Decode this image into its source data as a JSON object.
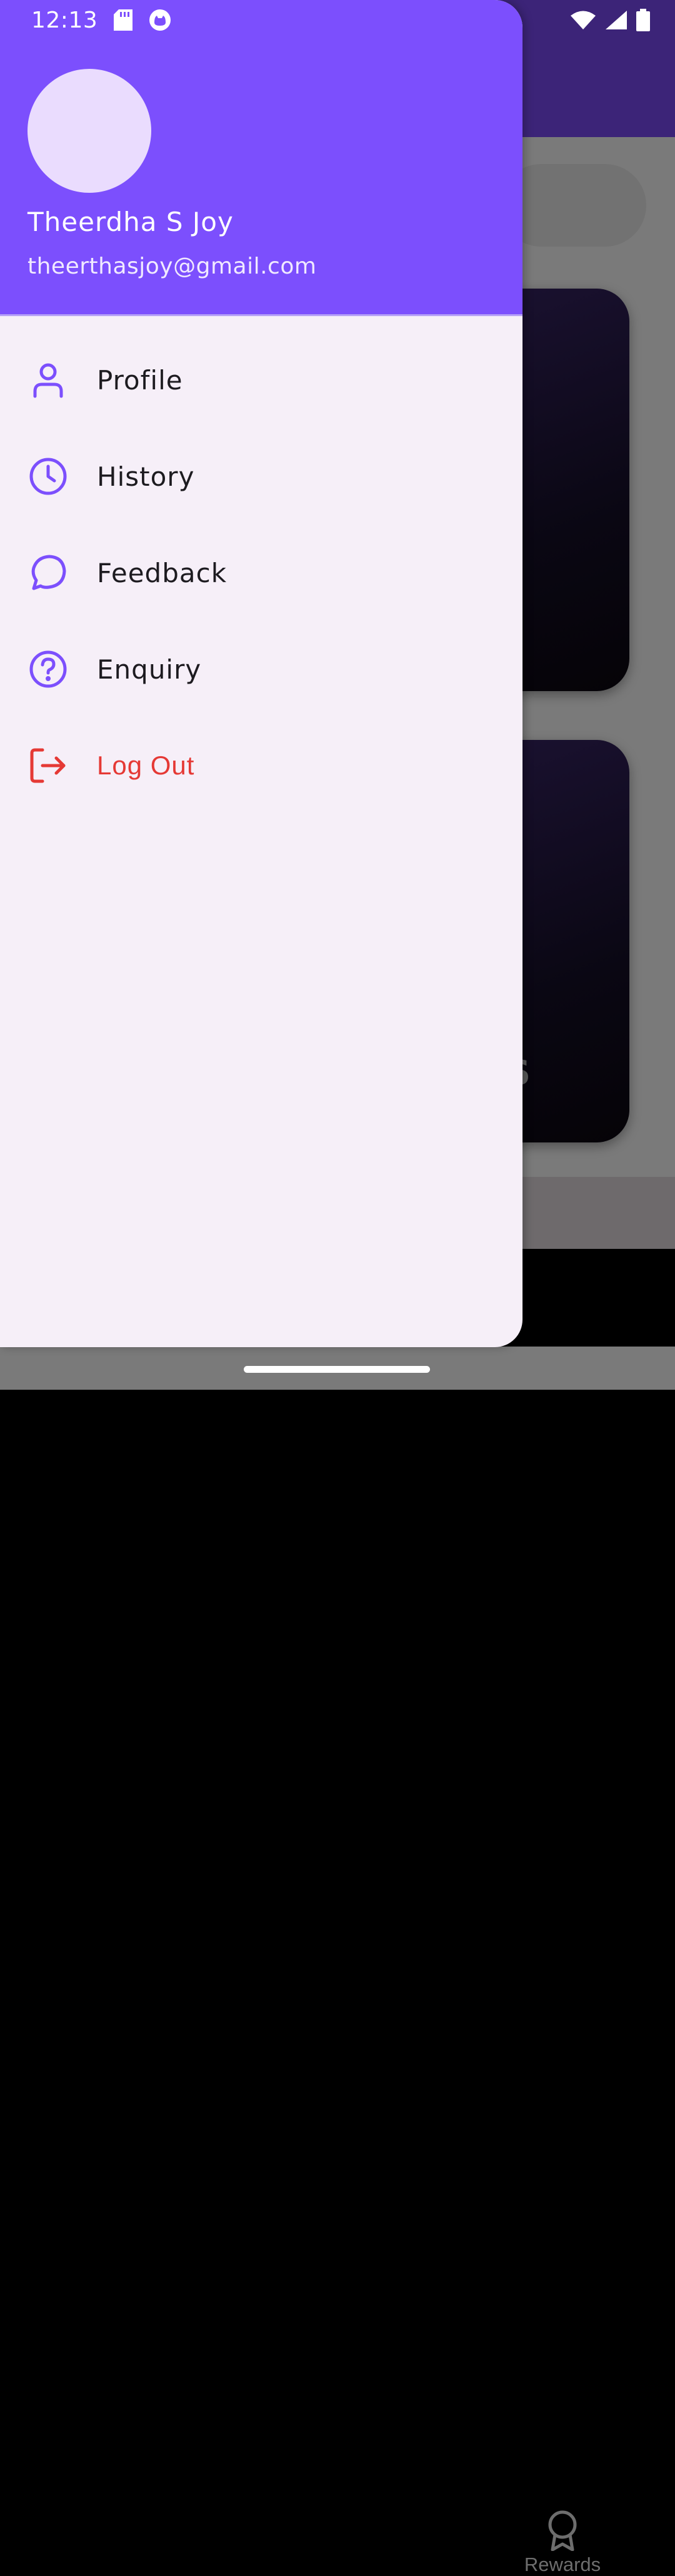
{
  "status_bar": {
    "time": "12:13",
    "icons": [
      "sd-card-icon",
      "app-notification-icon",
      "wifi-icon",
      "cell-signal-icon",
      "battery-icon"
    ]
  },
  "drawer": {
    "header": {
      "name": "Theerdha S Joy",
      "email": "theerthasjoy@gmail.com"
    },
    "items": [
      {
        "label": "Profile",
        "icon": "person-icon"
      },
      {
        "label": "History",
        "icon": "clock-icon"
      },
      {
        "label": "Feedback",
        "icon": "chat-bubble-icon"
      },
      {
        "label": "Enquiry",
        "icon": "help-circle-icon"
      },
      {
        "label": "Log Out",
        "icon": "logout-icon"
      }
    ]
  },
  "background": {
    "bottom_nav": {
      "rewards_label": "Rewards"
    }
  },
  "colors": {
    "accent": "#7c4ffd",
    "drawer_bg": "#f6eff8",
    "logout": "#e53935",
    "app_bar": "#3c2478"
  }
}
